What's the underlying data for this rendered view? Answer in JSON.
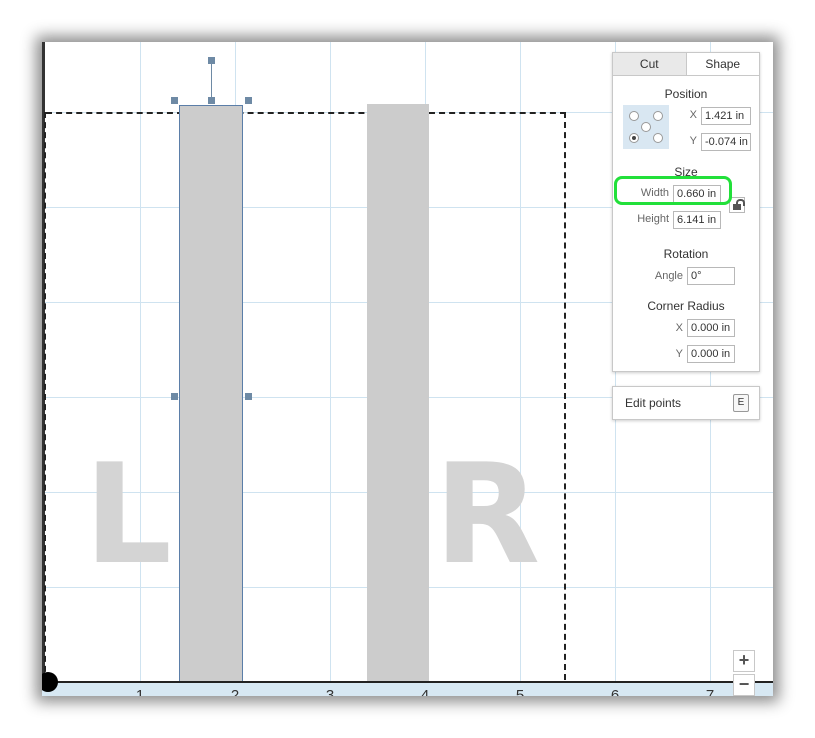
{
  "panel": {
    "tabs": [
      {
        "label": "Cut"
      },
      {
        "label": "Shape"
      }
    ],
    "position": {
      "title": "Position",
      "x_label": "X",
      "x_value": "1.421 in",
      "y_label": "Y",
      "y_value": "-0.074 in",
      "anchor_selected": "bottom-left"
    },
    "size": {
      "title": "Size",
      "width_label": "Width",
      "width_value": "0.660 in",
      "height_label": "Height",
      "height_value": "6.141 in",
      "lock_icon": "lock-icon"
    },
    "rotation": {
      "title": "Rotation",
      "angle_label": "Angle",
      "angle_value": "0°"
    },
    "corner_radius": {
      "title": "Corner Radius",
      "x_label": "X",
      "x_value": "0.000 in",
      "y_label": "Y",
      "y_value": "0.000 in"
    }
  },
  "edit_points": {
    "label": "Edit points",
    "shortcut": "E"
  },
  "canvas": {
    "letters": {
      "left": "L",
      "right": "R"
    },
    "ruler": [
      "1",
      "2",
      "3",
      "4",
      "5",
      "6",
      "7"
    ]
  },
  "zoom": {
    "in": "+",
    "out": "−"
  },
  "colors": {
    "grid": "#cfe3f0",
    "shape": "#cccccc",
    "selection": "#6e8aa5",
    "highlight": "#22e03a",
    "ruler": "#d7e8f3"
  }
}
